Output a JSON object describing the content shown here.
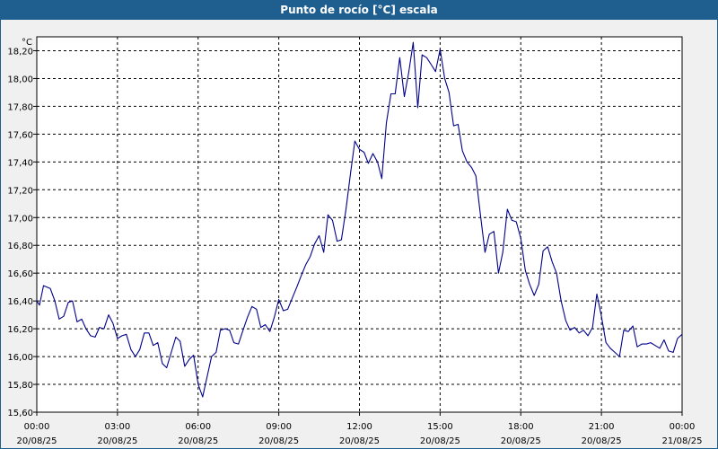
{
  "chart_data": {
    "type": "line",
    "title": "Punto de rocío [°C] escala",
    "ylabel": "°C",
    "xlabel": "",
    "ylim": [
      15.6,
      18.3
    ],
    "yticks": [
      15.6,
      15.8,
      16.0,
      16.2,
      16.4,
      16.6,
      16.8,
      17.0,
      17.2,
      17.4,
      17.6,
      17.8,
      18.0,
      18.2
    ],
    "ytick_labels": [
      "15,60",
      "15,80",
      "16,00",
      "16,20",
      "16,40",
      "16,60",
      "16,80",
      "17,00",
      "17,20",
      "17,40",
      "17,60",
      "17,80",
      "18,00",
      "18,20"
    ],
    "xlim": [
      0,
      24
    ],
    "xticks": [
      {
        "hour": 0,
        "time": "00:00",
        "date": "20/08/25"
      },
      {
        "hour": 3,
        "time": "03:00",
        "date": "20/08/25"
      },
      {
        "hour": 6,
        "time": "06:00",
        "date": "20/08/25"
      },
      {
        "hour": 9,
        "time": "09:00",
        "date": "20/08/25"
      },
      {
        "hour": 12,
        "time": "12:00",
        "date": "20/08/25"
      },
      {
        "hour": 15,
        "time": "15:00",
        "date": "20/08/25"
      },
      {
        "hour": 18,
        "time": "18:00",
        "date": "20/08/25"
      },
      {
        "hour": 21,
        "time": "21:00",
        "date": "20/08/25"
      },
      {
        "hour": 24,
        "time": "00:00",
        "date": "21/08/25"
      }
    ],
    "grid": true,
    "series": [
      {
        "color": "#00008b",
        "x": [
          0.0,
          0.1,
          0.25,
          0.5,
          0.67,
          0.83,
          1.0,
          1.17,
          1.33,
          1.5,
          1.67,
          1.83,
          2.0,
          2.17,
          2.33,
          2.5,
          2.67,
          2.83,
          3.0,
          3.17,
          3.33,
          3.5,
          3.67,
          3.83,
          4.0,
          4.17,
          4.33,
          4.5,
          4.67,
          4.83,
          5.0,
          5.17,
          5.33,
          5.5,
          5.67,
          5.83,
          6.0,
          6.17,
          6.33,
          6.5,
          6.67,
          6.83,
          7.0,
          7.17,
          7.33,
          7.5,
          7.67,
          7.83,
          8.0,
          8.17,
          8.33,
          8.5,
          8.67,
          8.83,
          9.0,
          9.17,
          9.33,
          9.5,
          9.67,
          9.83,
          10.0,
          10.17,
          10.33,
          10.5,
          10.67,
          10.83,
          11.0,
          11.17,
          11.33,
          11.5,
          11.67,
          11.83,
          12.0,
          12.17,
          12.33,
          12.5,
          12.67,
          12.83,
          13.0,
          13.17,
          13.33,
          13.5,
          13.67,
          13.83,
          14.0,
          14.17,
          14.33,
          14.5,
          14.67,
          14.83,
          15.0,
          15.17,
          15.33,
          15.5,
          15.67,
          15.83,
          16.0,
          16.17,
          16.33,
          16.5,
          16.67,
          16.83,
          17.0,
          17.17,
          17.33,
          17.5,
          17.67,
          17.83,
          18.0,
          18.17,
          18.33,
          18.5,
          18.67,
          18.83,
          19.0,
          19.17,
          19.33,
          19.5,
          19.67,
          19.83,
          20.0,
          20.17,
          20.33,
          20.5,
          20.67,
          20.83,
          21.0,
          21.17,
          21.33,
          21.5,
          21.67,
          21.83,
          22.0,
          22.17,
          22.33,
          22.5,
          22.67,
          22.83,
          23.0,
          23.17,
          23.33,
          23.5,
          23.67,
          23.83,
          24.0
        ],
        "y": [
          16.4,
          16.37,
          16.51,
          16.49,
          16.4,
          16.27,
          16.29,
          16.39,
          16.4,
          16.25,
          16.27,
          16.2,
          16.15,
          16.14,
          16.21,
          16.2,
          16.3,
          16.24,
          16.13,
          16.15,
          16.16,
          16.05,
          16.0,
          16.05,
          16.17,
          16.17,
          16.08,
          16.1,
          15.95,
          15.92,
          16.03,
          16.14,
          16.11,
          15.93,
          15.98,
          16.01,
          15.8,
          15.71,
          15.85,
          16.0,
          16.03,
          16.19,
          16.2,
          16.19,
          16.1,
          16.09,
          16.19,
          16.28,
          16.36,
          16.34,
          16.21,
          16.23,
          16.18,
          16.28,
          16.41,
          16.33,
          16.34,
          16.42,
          16.5,
          16.58,
          16.66,
          16.72,
          16.81,
          16.87,
          16.75,
          17.02,
          16.98,
          16.83,
          16.84,
          17.06,
          17.32,
          17.55,
          17.49,
          17.47,
          17.39,
          17.46,
          17.4,
          17.28,
          17.68,
          17.89,
          17.89,
          18.15,
          17.87,
          18.04,
          18.26,
          17.79,
          18.17,
          18.15,
          18.1,
          18.05,
          18.21,
          18.0,
          17.9,
          17.66,
          17.67,
          17.48,
          17.4,
          17.36,
          17.3,
          17.02,
          16.75,
          16.88,
          16.9,
          16.6,
          16.75,
          17.06,
          16.98,
          16.97,
          16.85,
          16.62,
          16.52,
          16.44,
          16.52,
          16.76,
          16.79,
          16.68,
          16.6,
          16.4,
          16.26,
          16.19,
          16.21,
          16.17,
          16.19,
          16.15,
          16.21,
          16.45,
          16.29,
          16.1,
          16.06,
          16.03,
          16.0,
          16.19,
          16.18,
          16.22,
          16.07,
          16.09,
          16.09,
          16.1,
          16.08,
          16.06,
          16.12,
          16.04,
          16.03,
          16.13,
          16.16
        ]
      }
    ]
  }
}
